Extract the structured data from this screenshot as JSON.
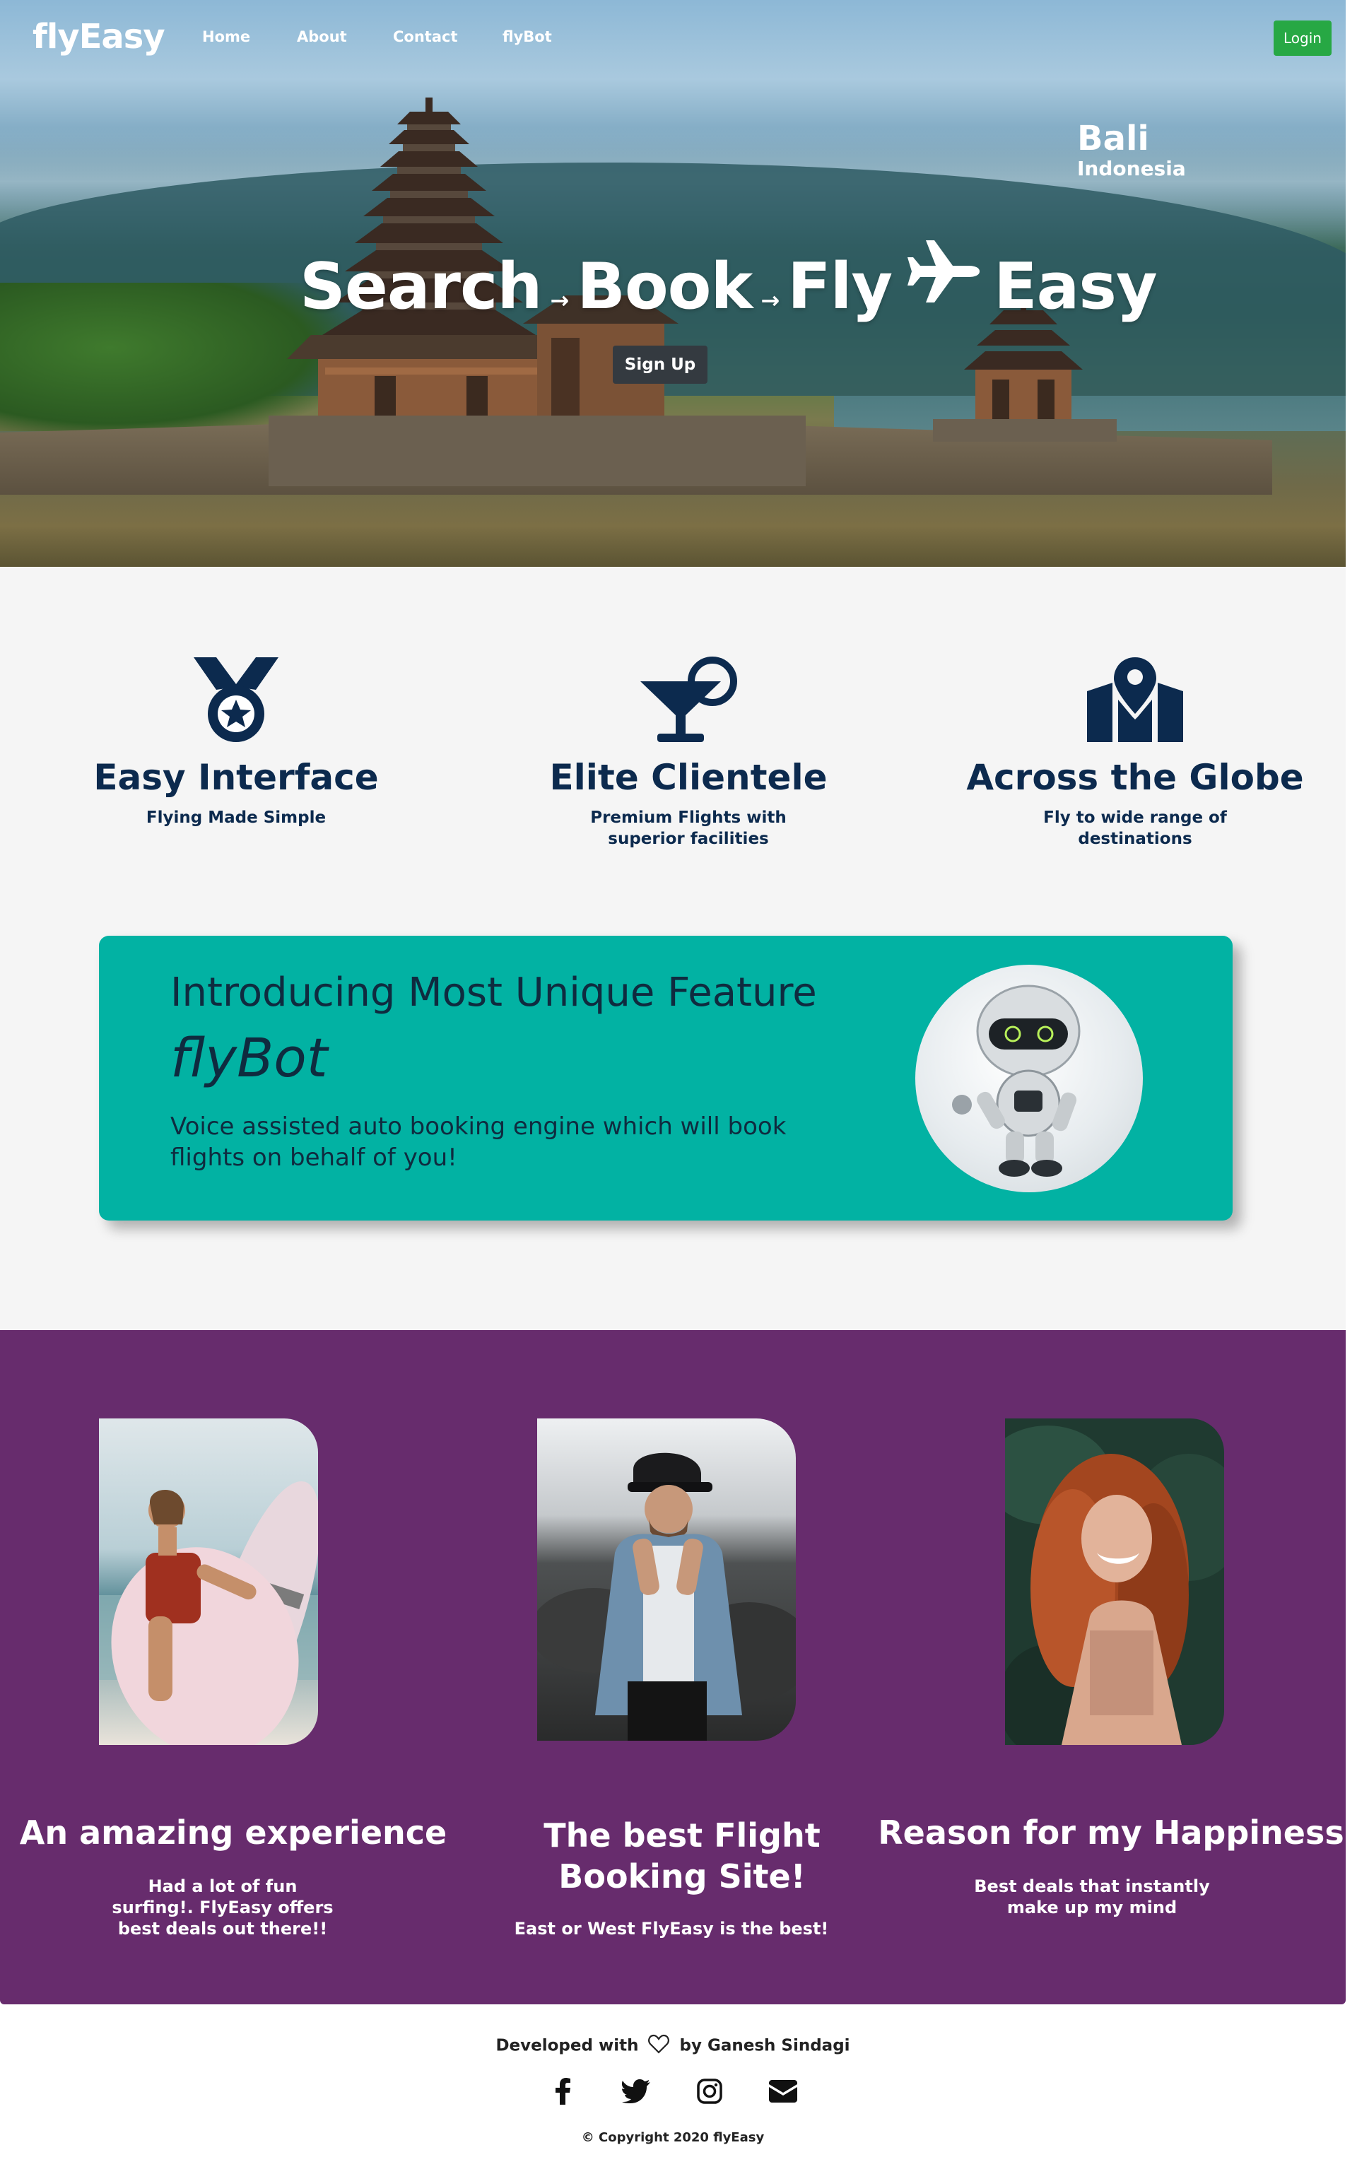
{
  "nav": {
    "brand": "flyEasy",
    "links": [
      "Home",
      "About",
      "Contact",
      "flyBot"
    ],
    "login_label": "Login"
  },
  "hero": {
    "city": "Bali",
    "country": "Indonesia",
    "headline": {
      "word1": "Search",
      "word2": "Book",
      "word3": "Fly",
      "word4": "Easy"
    },
    "signup_label": "Sign Up",
    "icons": [
      "arrow-right-icon",
      "airplane-icon"
    ]
  },
  "features": [
    {
      "icon": "medal-star-icon",
      "title": "Easy Interface",
      "desc": "Flying Made Simple"
    },
    {
      "icon": "cocktail-glass-icon",
      "title": "Elite Clientele",
      "desc": "Premium Flights with superior facilities"
    },
    {
      "icon": "map-pin-icon",
      "title": "Across the Globe",
      "desc": "Fly to wide range of destinations"
    }
  ],
  "flybot": {
    "intro": "Introducing Most Unique Feature",
    "name": "flyBot",
    "text": "Voice assisted auto booking engine which will book flights on behalf of you!",
    "image": "robot-image",
    "color": "#02b2a3"
  },
  "testimonials": [
    {
      "image": "woman-surfboard-photo",
      "title": "An amazing experience",
      "desc": "Had a lot of fun surfing!. FlyEasy offers best deals out there!!"
    },
    {
      "image": "man-denim-jacket-photo",
      "title": "The best Flight Booking Site!",
      "desc": "East or West FlyEasy is the best!"
    },
    {
      "image": "red-hair-woman-photo",
      "title": "Reason for my Happiness",
      "desc": "Best deals that instantly make up my mind"
    }
  ],
  "footer": {
    "developed_prefix": "Developed with",
    "developed_suffix": "by Ganesh Sindagi",
    "socials": [
      "facebook-icon",
      "twitter-icon",
      "instagram-icon",
      "envelope-icon"
    ],
    "copyright": "© Copyright 2020 flyEasy"
  },
  "colors": {
    "navy": "#0c2a4e",
    "teal": "#02b2a3",
    "purple": "#672c6d",
    "login_green": "#27a844",
    "signup_dark": "#343a40",
    "features_bg": "#f5f5f5"
  }
}
